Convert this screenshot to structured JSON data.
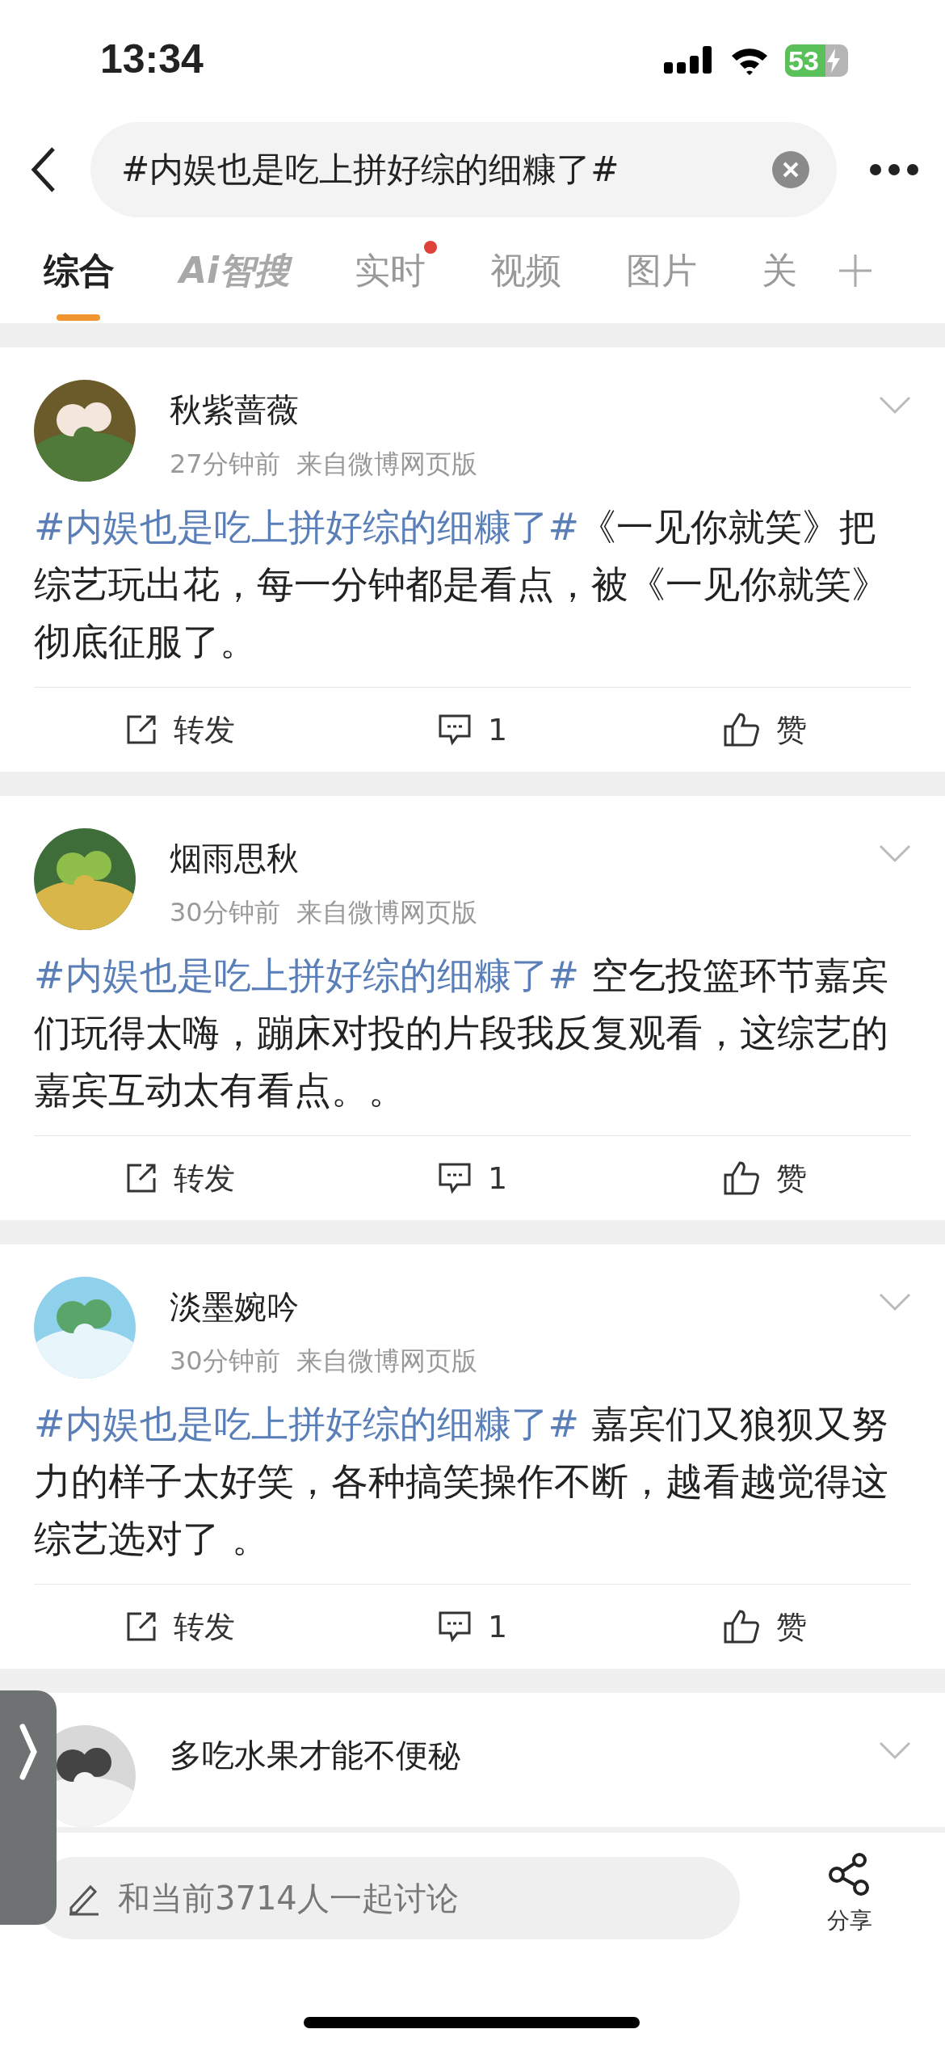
{
  "status_bar": {
    "time": "13:34",
    "battery": "53"
  },
  "search": {
    "value": "#内娱也是吃上拼好综的细糠了#"
  },
  "tabs": [
    {
      "label": "综合",
      "selected": true,
      "dot": false
    },
    {
      "label": "Ai智搜",
      "selected": false,
      "dot": false
    },
    {
      "label": "实时",
      "selected": false,
      "dot": true
    },
    {
      "label": "视频",
      "selected": false,
      "dot": false
    },
    {
      "label": "图片",
      "selected": false,
      "dot": false
    },
    {
      "label": "关",
      "selected": false,
      "dot": false
    }
  ],
  "posts": [
    {
      "author": "秋紫蔷薇",
      "time": "27分钟前",
      "source": "来自微博网页版",
      "topic": "#内娱也是吃上拼好综的细糠了#",
      "text": "《一见你就笑》把综艺玩出花，每一分钟都是看点，被《一见你就笑》彻底征服了。",
      "repost": "转发",
      "comments": "1",
      "like": "赞"
    },
    {
      "author": "烟雨思秋",
      "time": "30分钟前",
      "source": "来自微博网页版",
      "topic": "#内娱也是吃上拼好综的细糠了#",
      "text": " 空乞投篮环节嘉宾们玩得太嗨，蹦床对投的片段我反复观看，这综艺的嘉宾互动太有看点。。",
      "repost": "转发",
      "comments": "1",
      "like": "赞"
    },
    {
      "author": "淡墨婉吟",
      "time": "30分钟前",
      "source": "来自微博网页版",
      "topic": "#内娱也是吃上拼好综的细糠了#",
      "text": " 嘉宾们又狼狈又努力的样子太好笑，各种搞笑操作不断，越看越觉得这综艺选对了 。",
      "repost": "转发",
      "comments": "1",
      "like": "赞"
    },
    {
      "author": "多吃水果才能不便秘"
    }
  ],
  "bottom_bar": {
    "placeholder": "和当前3714人一起讨论",
    "share": "分享"
  }
}
